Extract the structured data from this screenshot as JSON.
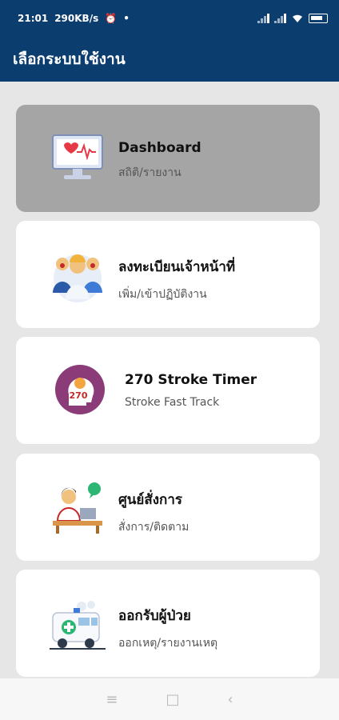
{
  "status_bar": {
    "time": "21:01",
    "network_speed": "290KB/s",
    "battery_level": "100"
  },
  "app_bar": {
    "title": "เลือกระบบใช้งาน"
  },
  "menu": [
    {
      "title": "Dashboard",
      "subtitle": "สถิติ/รายงาน",
      "icon": "monitor-heartbeat-icon",
      "selected": true
    },
    {
      "title": "ลงทะเบียนเจ้าหน้าที่",
      "subtitle": "เพิ่ม/เข้าปฏิบัติงาน",
      "icon": "medical-staff-icon",
      "selected": false
    },
    {
      "title": "270 Stroke Timer",
      "subtitle": "Stroke Fast Track",
      "icon": "brain-270-icon",
      "badge": "270",
      "selected": false
    },
    {
      "title": "ศูนย์สั่งการ",
      "subtitle": "สั่งการ/ติดตาม",
      "icon": "command-center-icon",
      "selected": false
    },
    {
      "title": "ออกรับผู้ป่วย",
      "subtitle": "ออกเหตุ/รายงานเหตุ",
      "icon": "ambulance-icon",
      "selected": false
    }
  ],
  "nav": {
    "menu": "≡",
    "home": "□",
    "back": "‹"
  },
  "colors": {
    "primary": "#0b3d6e",
    "selected_card": "#a5a5a5",
    "background": "#e6e6e6"
  }
}
